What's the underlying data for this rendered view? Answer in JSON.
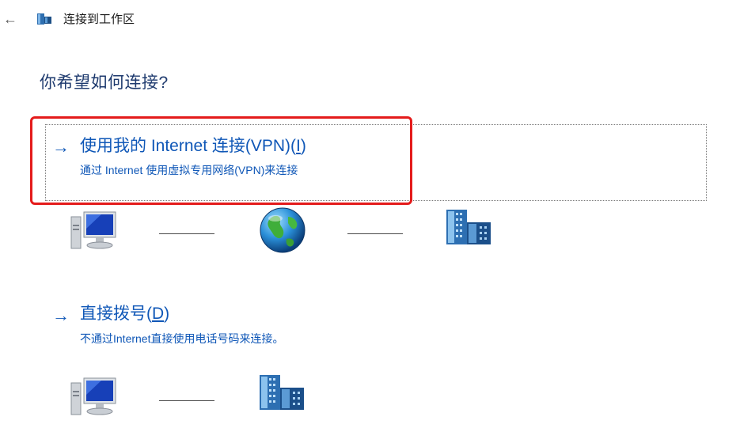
{
  "header": {
    "back_glyph": "←",
    "title": "连接到工作区",
    "icon": "workplace-building-icon"
  },
  "question": "你希望如何连接?",
  "options": [
    {
      "arrow": "→",
      "title_prefix": "使用我的 Internet 连接(VPN)(",
      "accelerator": "I",
      "title_suffix": ")",
      "description": "通过 Internet 使用虚拟专用网络(VPN)来连接",
      "selected": true,
      "diagram": [
        "computer-icon",
        "globe-icon",
        "workplace-building-icon"
      ]
    },
    {
      "arrow": "→",
      "title_prefix": "直接拨号(",
      "accelerator": "D",
      "title_suffix": ")",
      "description": "不通过Internet直接使用电话号码来连接。",
      "selected": false,
      "diagram": [
        "computer-icon",
        "workplace-building-icon"
      ]
    }
  ],
  "colors": {
    "link": "#0f57b7",
    "heading": "#1e3a6e",
    "highlight": "#e41b1b"
  }
}
